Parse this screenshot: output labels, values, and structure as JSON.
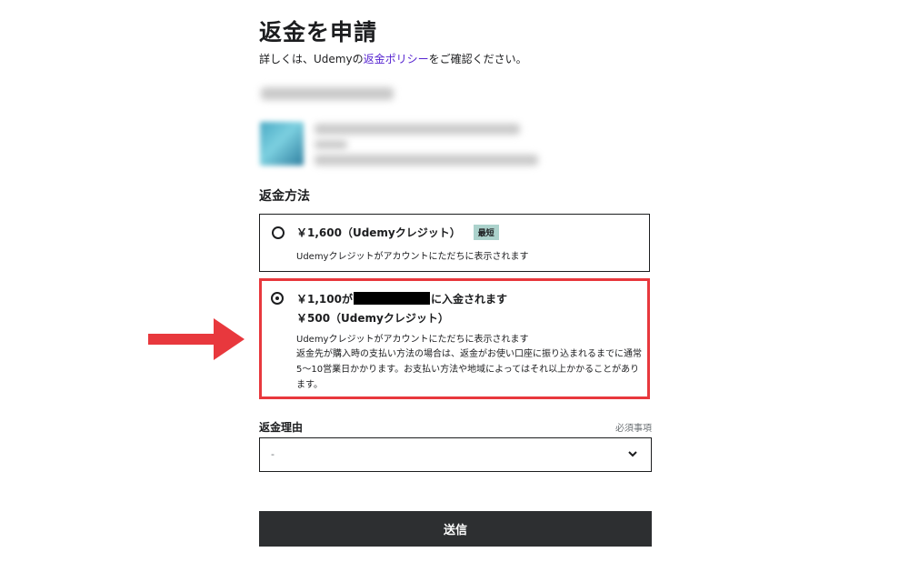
{
  "page": {
    "title": "返金を申請"
  },
  "subtitle": {
    "prefix": "詳しくは、Udemyの",
    "link": "返金ポリシー",
    "suffix": "をご確認ください。"
  },
  "refund_method": {
    "label": "返金方法",
    "options": [
      {
        "main": "￥1,600（Udemyクレジット）",
        "badge": "最短",
        "sub": "Udemyクレジットがアカウントにただちに表示されます",
        "selected": false
      },
      {
        "main_prefix": "￥1,100が",
        "main_suffix": "に入金されます",
        "main2": "￥500（Udemyクレジット）",
        "sub": "Udemyクレジットがアカウントにただちに表示されます",
        "note": "返金先が購入時の支払い方法の場合は、返金がお使い口座に振り込まれるまでに通常5〜10営業日かかります。お支払い方法や地域によってはそれ以上かかることがあります。",
        "selected": true,
        "highlight_color": "#e8383d"
      }
    ]
  },
  "refund_reason": {
    "label": "返金理由",
    "required_text": "必須事項",
    "selected_value": "-"
  },
  "submit": {
    "label": "送信"
  },
  "colors": {
    "accent_link": "#5624d0",
    "highlight": "#e8383d",
    "button_bg": "#2d2f31",
    "badge_bg": "#acd2cc"
  },
  "icons": {
    "arrow": "right-arrow-icon",
    "chevron": "chevron-down-icon"
  }
}
